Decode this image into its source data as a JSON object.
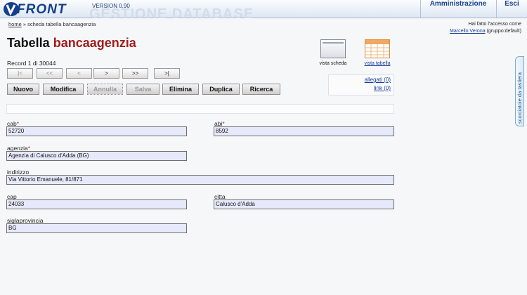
{
  "header": {
    "logo_text": "FRONT",
    "version": "VERSION 0.90",
    "watermark": "GESTIONE DATABASE",
    "admin_label": "Amministrazione",
    "exit_label": "Esci"
  },
  "breadcrumb": {
    "home": "home",
    "separator": " » ",
    "current": "scheda tabella bancaagenzia"
  },
  "access": {
    "line1": "Hai fatto l'accesso come",
    "user": "Marcello Verona",
    "group": "(gruppo:default)"
  },
  "title": {
    "prefix": "Tabella ",
    "table_name": "bancaagenzia"
  },
  "views": {
    "scheda": "vista scheda",
    "tabella": "vista tabella"
  },
  "record_info": "Record 1 di 30044",
  "nav": [
    {
      "label": "|<",
      "disabled": true
    },
    {
      "label": "<<",
      "disabled": true
    },
    {
      "label": "<",
      "disabled": true
    },
    {
      "label": ">",
      "disabled": false
    },
    {
      "label": ">>",
      "disabled": false
    },
    {
      "label": ">|",
      "disabled": false
    }
  ],
  "actions": {
    "nuovo": "Nuovo",
    "modifica": "Modifica",
    "annulla": "Annulla",
    "salva": "Salva",
    "elimina": "Elimina",
    "duplica": "Duplica",
    "ricerca": "Ricerca"
  },
  "attachments": {
    "allegati": "allegati (0)",
    "link": "link (0)"
  },
  "side_tab": "scorciatoie da tastiera",
  "fields": {
    "cab": {
      "label": "cab",
      "value": "52720"
    },
    "abi": {
      "label": "abi",
      "value": "8592"
    },
    "agenzia": {
      "label": "agenzia",
      "value": "Agenzia di Calusco d'Adda (BG)"
    },
    "indirizzo": {
      "label": "indirizzo",
      "value": "Via Vittorio Emanuele, 81/871"
    },
    "cap": {
      "label": "cap",
      "value": "24033"
    },
    "citta": {
      "label": "citta",
      "value": "Calusco d'Adda"
    },
    "siglaprovincia": {
      "label": "siglaprovincia",
      "value": "BG"
    }
  },
  "required_mark": "*",
  "colors": {
    "brand": "#153f8c",
    "table_name": "#a51b1b",
    "input_bg": "#e7e9fb"
  }
}
